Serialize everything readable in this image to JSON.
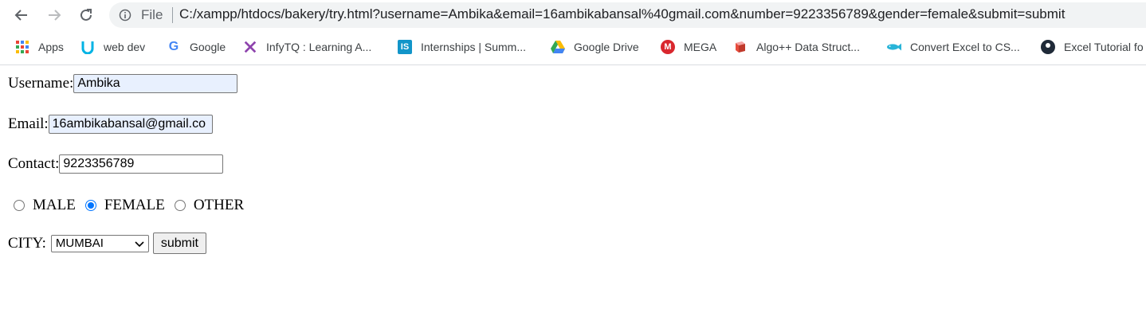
{
  "toolbar": {
    "file_label": "File",
    "url": "C:/xampp/htdocs/bakery/try.html?username=Ambika&email=16ambikabansal%40gmail.com&number=9223356789&gender=female&submit=submit"
  },
  "bookmarks": [
    {
      "label": "Apps",
      "icon": "apps-grid-icon"
    },
    {
      "label": "web dev",
      "icon": "udacity-icon"
    },
    {
      "label": "Google",
      "icon": "google-icon"
    },
    {
      "label": "InfyTQ : Learning A...",
      "icon": "infytq-icon"
    },
    {
      "label": "Internships | Summ...",
      "icon": "internshala-icon"
    },
    {
      "label": "Google Drive",
      "icon": "google-drive-icon"
    },
    {
      "label": "MEGA",
      "icon": "mega-icon"
    },
    {
      "label": "Algo++ Data Struct...",
      "icon": "codingblocks-icon"
    },
    {
      "label": "Convert Excel to CS...",
      "icon": "fish-icon"
    },
    {
      "label": "Excel Tutorial fo",
      "icon": "excel-tutorial-icon"
    }
  ],
  "form": {
    "username_label": "Username:",
    "username_value": "Ambika",
    "email_label": "Email:",
    "email_value": "16ambikabansal@gmail.co",
    "contact_label": "Contact:",
    "contact_value": "9223356789",
    "gender_options": [
      {
        "label": "MALE",
        "checked": false
      },
      {
        "label": "FEMALE",
        "checked": true
      },
      {
        "label": "OTHER",
        "checked": false
      }
    ],
    "city_label": "CITY:",
    "city_selected": "MUMBAI",
    "submit_label": "submit"
  },
  "colors": {
    "accent": "#0075ff",
    "autofill_bg": "#e8f0fe"
  }
}
